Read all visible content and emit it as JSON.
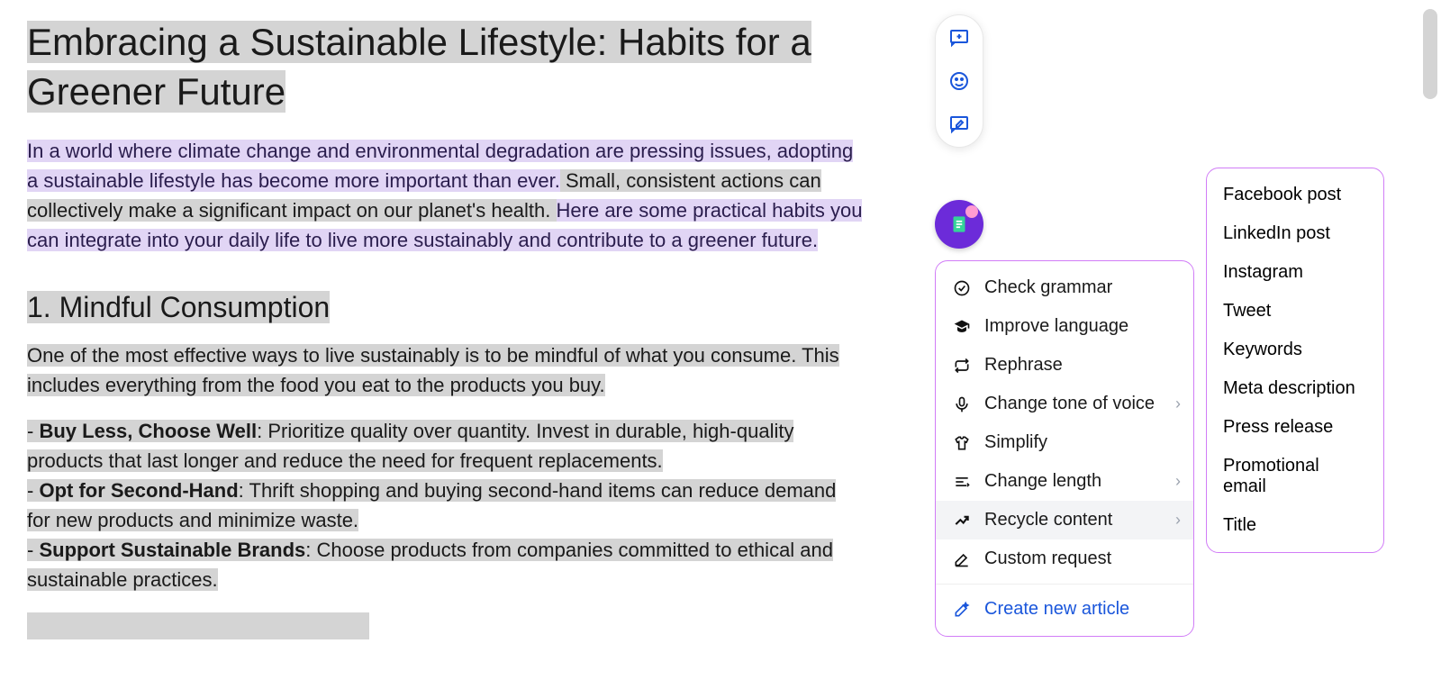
{
  "document": {
    "title": "Embracing a Sustainable Lifestyle: Habits for a Greener Future",
    "intro": {
      "s1": "In a world where climate change and environmental degradation are pressing issues, adopting a sustainable lifestyle has become more important than ever.",
      "s2": " Small, consistent actions can collectively make a significant impact on our planet's health. ",
      "s3": "Here are some practical habits you can integrate into your daily life to live more sustainably and contribute to a greener future."
    },
    "section1_heading": "1. Mindful Consumption",
    "section1_p": "One of the most effective ways to live sustainably is to be mindful of what you consume. This includes everything from the food you eat to the products you buy.",
    "bullets": {
      "b1_title": "Buy Less, Choose Well",
      "b1_text": ": Prioritize quality over quantity. Invest in durable, high-quality products that last longer and reduce the need for frequent replacements.",
      "b2_title": "Opt for Second-Hand",
      "b2_text": ": Thrift shopping and buying second-hand items can reduce demand for new products and minimize waste.",
      "b3_title": "Support Sustainable Brands",
      "b3_text": ": Choose products from companies committed to ethical and sustainable practices."
    }
  },
  "menu": {
    "items": [
      "Check grammar",
      "Improve language",
      "Rephrase",
      "Change tone of voice",
      "Simplify",
      "Change length",
      "Recycle content",
      "Custom request"
    ],
    "create_new": "Create new article"
  },
  "submenu": {
    "items": [
      "Facebook post",
      "LinkedIn post",
      "Instagram",
      "Tweet",
      "Keywords",
      "Meta description",
      "Press release",
      "Promotional email",
      "Title"
    ]
  }
}
